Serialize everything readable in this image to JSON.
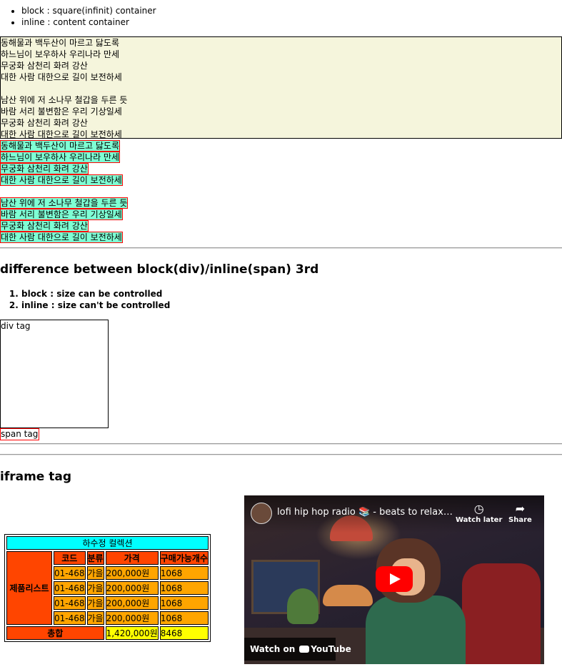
{
  "intro_list": [
    "block : square(infinit) container",
    "inline : content container"
  ],
  "poem": [
    "동해물과 백두산이 마르고 닳도록",
    "하느님이 보우하사 우리나라 만세",
    "무궁화 삼천리 화려 강산",
    "대한 사람 대한으로 길이 보전하세",
    "",
    "남산 위에 저 소나무 철갑을 두른 듯",
    "바람 서리 불변함은 우리 기상일세",
    "무궁화 삼천리 화려 강산",
    "대한 사람 대한으로 길이 보전하세"
  ],
  "section3": {
    "title": "difference between block(div)/inline(span) 3rd",
    "items": [
      "block : size can be controlled",
      "inline : size can't be controlled"
    ],
    "div_label": "div tag",
    "span_label": "span tag"
  },
  "iframe_section": {
    "title": "iframe tag"
  },
  "table": {
    "caption": "하수정 컬렉션",
    "headers": [
      "코드",
      "분류",
      "가격",
      "구매가능개수"
    ],
    "side_label": "제품리스트",
    "rows": [
      [
        "01-468",
        "가을",
        "200,000원",
        "1068"
      ],
      [
        "01-468",
        "가을",
        "200,000원",
        "1068"
      ],
      [
        "01-468",
        "가을",
        "200,000원",
        "1068"
      ],
      [
        "01-468",
        "가을",
        "200,000원",
        "1068"
      ]
    ],
    "total_label": "총합",
    "total_price": "1,420,000원",
    "total_count": "8468",
    "colors": {
      "caption": "#00ffff",
      "header": "#ff4500",
      "cell": "#ffa500",
      "total": "#ffff00"
    }
  },
  "video": {
    "title": "lofi hip hop radio 📚 - beats to relax/study to",
    "watch_later": "Watch later",
    "share": "Share",
    "watch_on": "Watch on",
    "youtube": "YouTube",
    "play_color": "#ff0000"
  }
}
